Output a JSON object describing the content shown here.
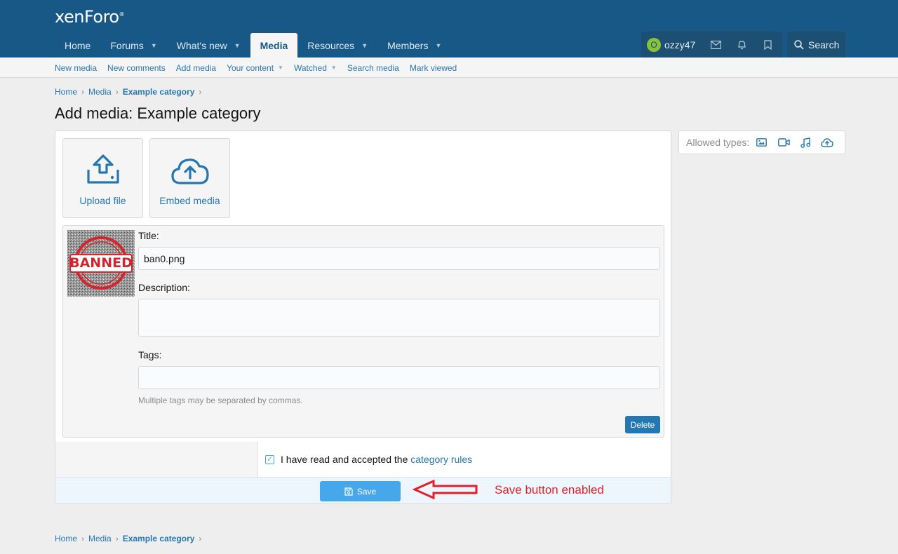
{
  "header": {
    "logo": "xenForo",
    "logo_mark": "®",
    "nav": [
      {
        "label": "Home",
        "has_caret": false,
        "active": false
      },
      {
        "label": "Forums",
        "has_caret": true,
        "active": false
      },
      {
        "label": "What's new",
        "has_caret": true,
        "active": false
      },
      {
        "label": "Media",
        "has_caret": false,
        "active": true
      },
      {
        "label": "Resources",
        "has_caret": true,
        "active": false
      },
      {
        "label": "Members",
        "has_caret": true,
        "active": false
      }
    ],
    "user": {
      "avatar_letter": "O",
      "name": "ozzy47"
    },
    "icons": [
      "envelope-icon",
      "bell-icon",
      "bookmark-icon"
    ],
    "search_label": "Search"
  },
  "subnav": [
    {
      "label": "New media",
      "has_caret": false
    },
    {
      "label": "New comments",
      "has_caret": false
    },
    {
      "label": "Add media",
      "has_caret": false
    },
    {
      "label": "Your content",
      "has_caret": true
    },
    {
      "label": "Watched",
      "has_caret": true
    },
    {
      "label": "Search media",
      "has_caret": false
    },
    {
      "label": "Mark viewed",
      "has_caret": false
    }
  ],
  "breadcrumbs": [
    "Home",
    "Media",
    "Example category"
  ],
  "page_title": "Add media: Example category",
  "upload": {
    "upload_file_label": "Upload file",
    "embed_media_label": "Embed media"
  },
  "media_item": {
    "thumb_text": "BANNED",
    "title_label": "Title:",
    "title_value": "ban0.png",
    "description_label": "Description:",
    "description_value": "",
    "tags_label": "Tags:",
    "tags_value": "",
    "tags_hint": "Multiple tags may be separated by commas.",
    "delete_label": "Delete"
  },
  "rules": {
    "checked": true,
    "text": "I have read and accepted the",
    "link": "category rules"
  },
  "save_label": "Save",
  "annotation": "Save button enabled",
  "sidebar": {
    "allowed_label": "Allowed types:",
    "types": [
      "image-icon",
      "video-icon",
      "audio-icon",
      "embed-icon"
    ]
  },
  "colors": {
    "header_bg": "#185886",
    "link": "#2577b1",
    "save_button": "#47a7eb",
    "annotation": "#e0202a"
  }
}
